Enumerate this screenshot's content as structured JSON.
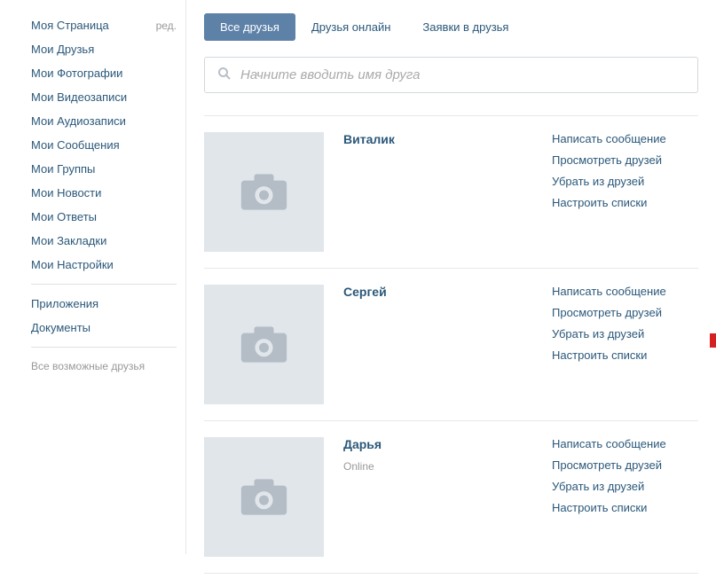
{
  "sidebar": {
    "items": [
      {
        "label": "Моя Страница",
        "edit": "ред."
      },
      {
        "label": "Мои Друзья"
      },
      {
        "label": "Мои Фотографии"
      },
      {
        "label": "Мои Видеозаписи"
      },
      {
        "label": "Мои Аудиозаписи"
      },
      {
        "label": "Мои Сообщения"
      },
      {
        "label": "Мои Группы"
      },
      {
        "label": "Мои Новости"
      },
      {
        "label": "Мои Ответы"
      },
      {
        "label": "Мои Закладки"
      },
      {
        "label": "Мои Настройки"
      }
    ],
    "secondary": [
      {
        "label": "Приложения"
      },
      {
        "label": "Документы"
      }
    ],
    "muted": "Все возможные друзья"
  },
  "tabs": [
    {
      "label": "Все друзья",
      "active": true
    },
    {
      "label": "Друзья онлайн",
      "active": false
    },
    {
      "label": "Заявки в друзья",
      "active": false
    }
  ],
  "search": {
    "placeholder": "Начните вводить имя друга"
  },
  "friends": [
    {
      "name": "Виталик",
      "online": false,
      "actions": [
        "Написать сообщение",
        "Просмотреть друзей",
        "Убрать из друзей",
        "Настроить списки"
      ]
    },
    {
      "name": "Сергей",
      "online": false,
      "highlighted_action_index": 2,
      "actions": [
        "Написать сообщение",
        "Просмотреть друзей",
        "Убрать из друзей",
        "Настроить списки"
      ]
    },
    {
      "name": "Дарья",
      "online": true,
      "online_label": "Online",
      "actions": [
        "Написать сообщение",
        "Просмотреть друзей",
        "Убрать из друзей",
        "Настроить списки"
      ]
    }
  ]
}
